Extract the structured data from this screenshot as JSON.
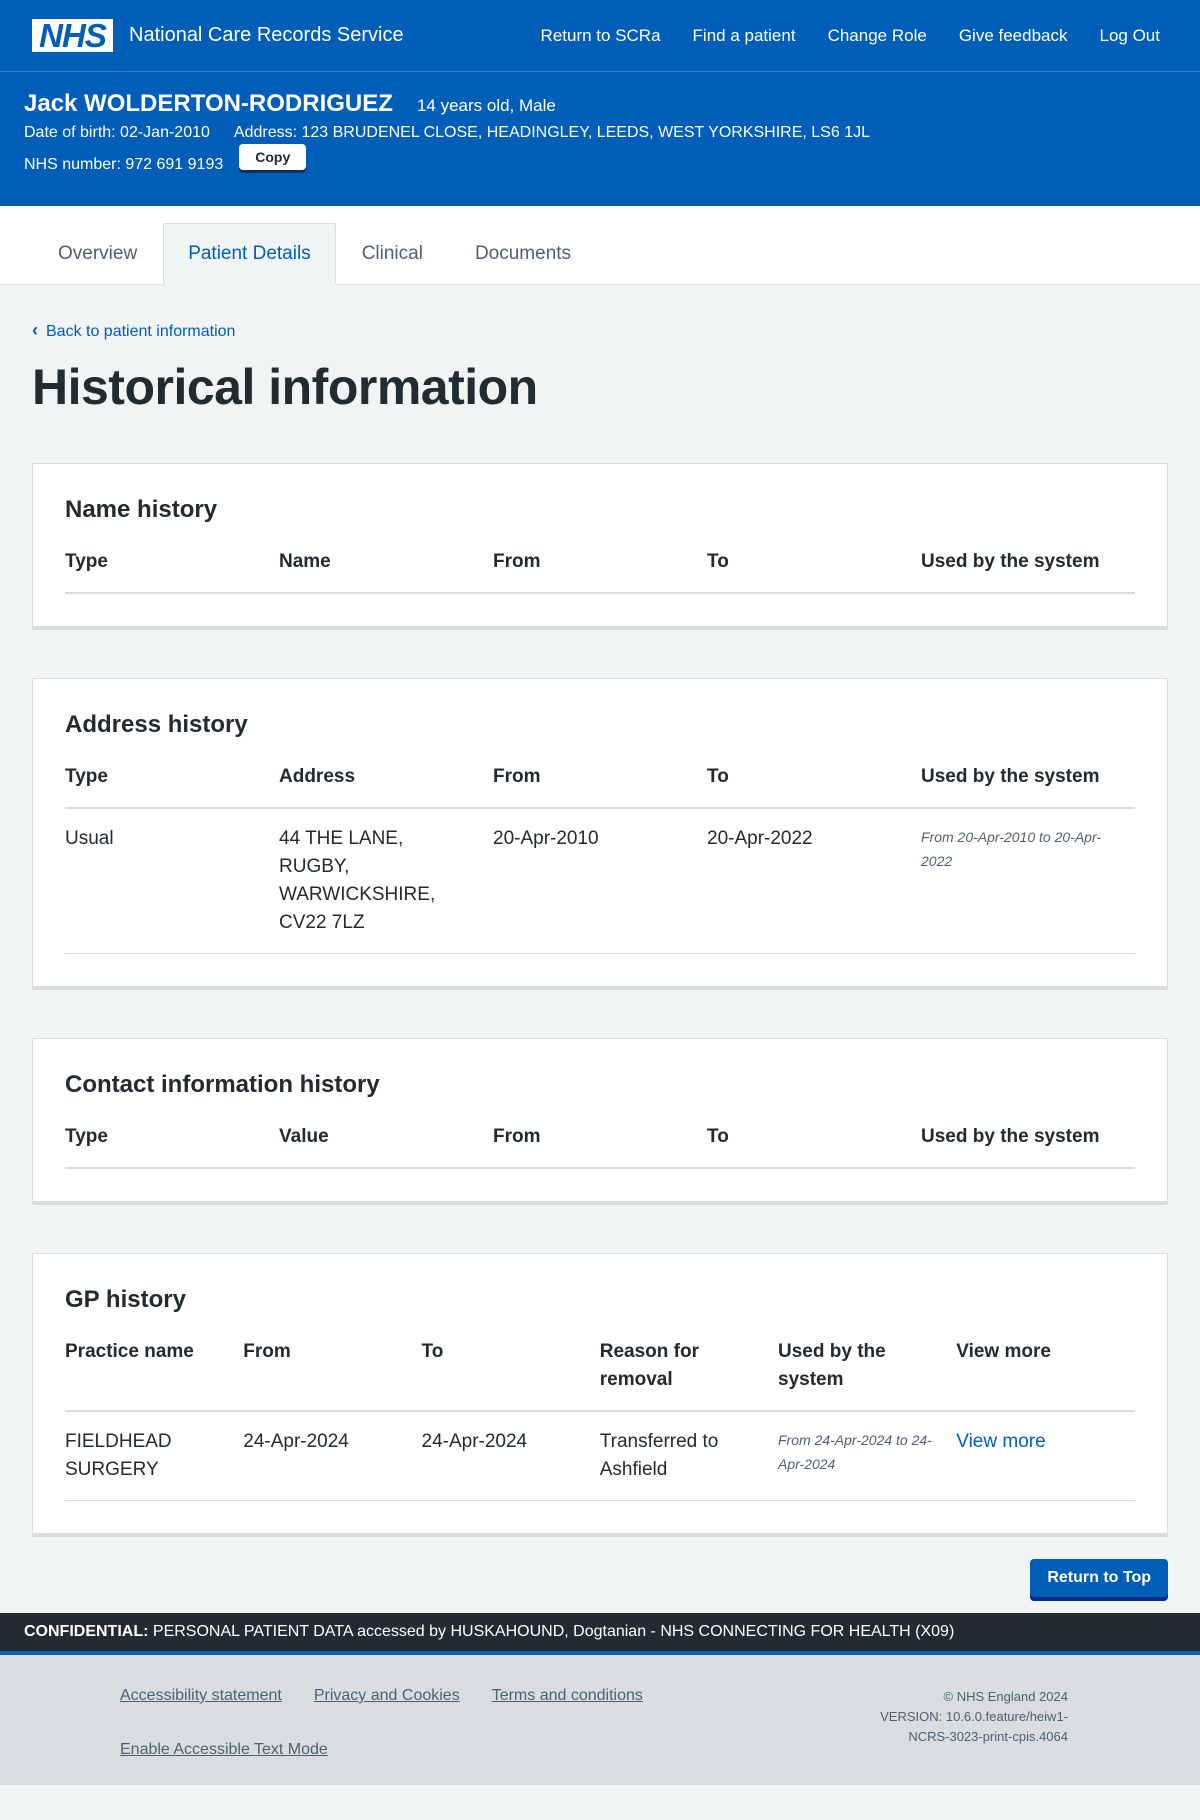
{
  "header": {
    "logo": "NHS",
    "service_name": "National Care Records Service",
    "nav": [
      "Return to SCRa",
      "Find a patient",
      "Change Role",
      "Give feedback",
      "Log Out"
    ]
  },
  "patient": {
    "name": "Jack WOLDERTON-RODRIGUEZ",
    "age_sex": "14 years old, Male",
    "dob": "Date of birth: 02-Jan-2010",
    "address": "Address: 123 BRUDENEL CLOSE, HEADINGLEY, LEEDS, WEST YORKSHIRE, LS6 1JL",
    "nhs_number": "NHS number: 972 691 9193",
    "copy_label": "Copy"
  },
  "tabs": [
    {
      "label": "Overview",
      "active": false
    },
    {
      "label": "Patient Details",
      "active": true
    },
    {
      "label": "Clinical",
      "active": false
    },
    {
      "label": "Documents",
      "active": false
    }
  ],
  "back_link": "Back to patient information",
  "page_title": "Historical information",
  "name_history": {
    "title": "Name history",
    "headers": [
      "Type",
      "Name",
      "From",
      "To",
      "Used by the system"
    ]
  },
  "address_history": {
    "title": "Address history",
    "headers": [
      "Type",
      "Address",
      "From",
      "To",
      "Used by the system"
    ],
    "rows": [
      {
        "type": "Usual",
        "address": "44 THE LANE, RUGBY, WARWICKSHIRE, CV22 7LZ",
        "from": "20-Apr-2010",
        "to": "20-Apr-2022",
        "used": "From 20-Apr-2010 to 20-Apr-2022"
      }
    ]
  },
  "contact_history": {
    "title": "Contact information history",
    "headers": [
      "Type",
      "Value",
      "From",
      "To",
      "Used by the system"
    ]
  },
  "gp_history": {
    "title": "GP history",
    "headers": [
      "Practice name",
      "From",
      "To",
      "Reason for removal",
      "Used by the system",
      "View more"
    ],
    "rows": [
      {
        "practice": "FIELDHEAD SURGERY",
        "from": "24-Apr-2024",
        "to": "24-Apr-2024",
        "reason": "Transferred to Ashfield",
        "used": "From 24-Apr-2024 to 24-Apr-2024",
        "view_more": "View more"
      }
    ]
  },
  "return_to_top": "Return to Top",
  "confidential": {
    "label": "CONFIDENTIAL:",
    "text": "PERSONAL PATIENT DATA accessed by HUSKAHOUND, Dogtanian - NHS CONNECTING FOR HEALTH (X09)"
  },
  "footer": {
    "links": [
      "Accessibility statement",
      "Privacy and Cookies",
      "Terms and conditions",
      "Enable Accessible Text Mode"
    ],
    "copyright": "© NHS England 2024",
    "version": "VERSION: 10.6.0.feature/heiw1-NCRS-3023-print-cpis.4064"
  }
}
